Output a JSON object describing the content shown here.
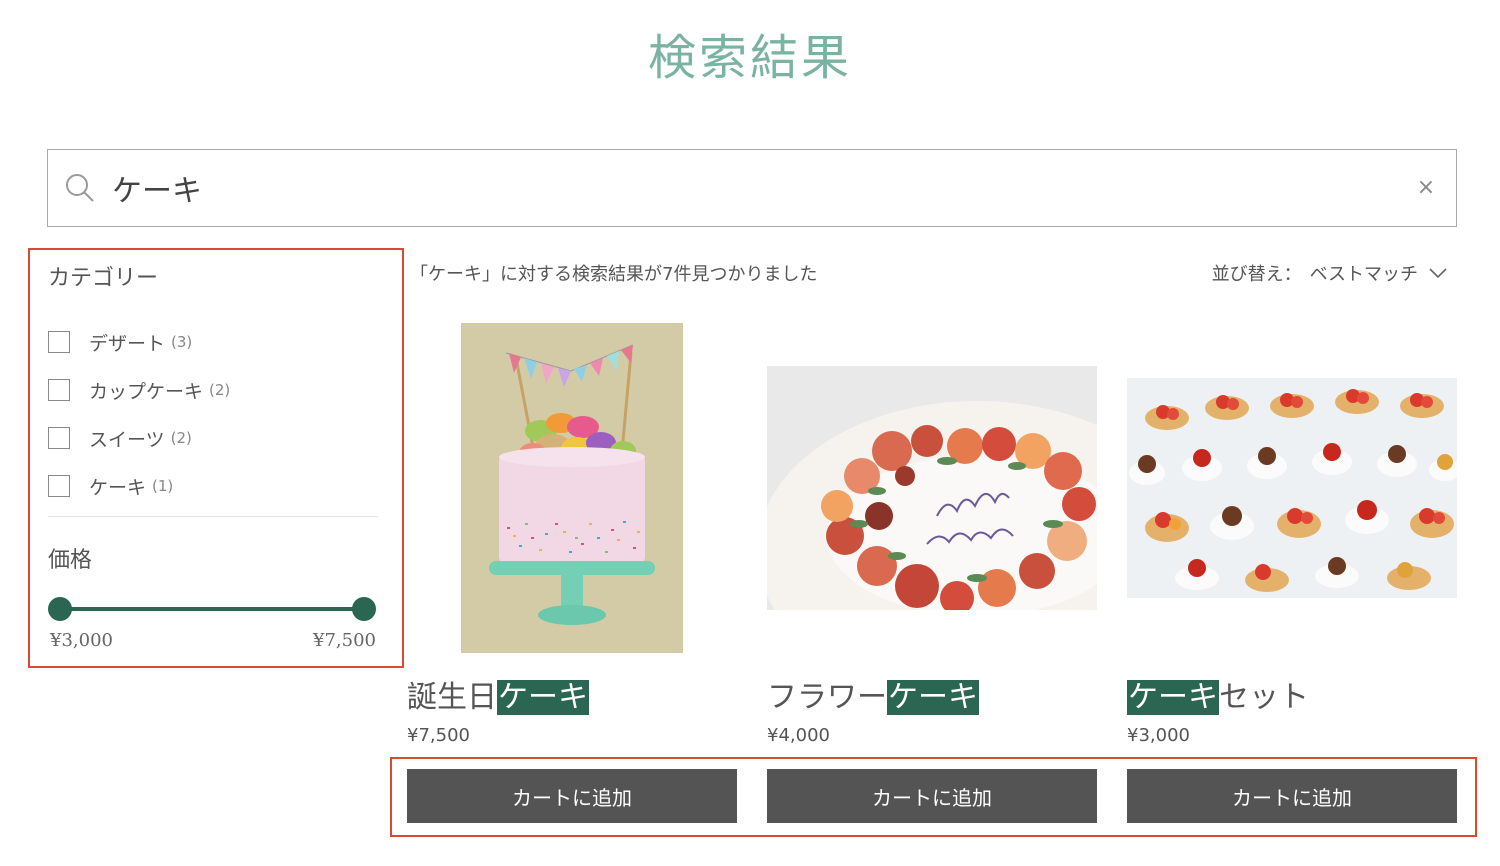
{
  "header": {
    "title": "検索結果"
  },
  "search": {
    "query": "ケーキ",
    "clear_label": "×"
  },
  "filters": {
    "category_heading": "カテゴリー",
    "categories": [
      {
        "label": "デザート",
        "count": "(3)"
      },
      {
        "label": "カップケーキ",
        "count": "(2)"
      },
      {
        "label": "スイーツ",
        "count": "(2)"
      },
      {
        "label": "ケーキ",
        "count": "(1)"
      }
    ],
    "price_heading": "価格",
    "price_min": "¥3,000",
    "price_max": "¥7,500"
  },
  "results": {
    "summary": "「ケーキ」に対する検索結果が7件見つかりました",
    "sort_label": "並び替え：",
    "sort_value": "ベストマッチ"
  },
  "products": [
    {
      "name_before": "誕生日",
      "name_match": "ケーキ",
      "name_after": "",
      "price": "¥7,500",
      "cart_label": "カートに追加"
    },
    {
      "name_before": "フラワー",
      "name_match": "ケーキ",
      "name_after": "",
      "price": "¥4,000",
      "cart_label": "カートに追加"
    },
    {
      "name_before": "",
      "name_match": "ケーキ",
      "name_after": "セット",
      "price": "¥3,000",
      "cart_label": "カートに追加"
    }
  ],
  "colors": {
    "title": "#7bb3a2",
    "accent": "#2a6651",
    "button": "#545454",
    "annotation_border": "#d94a34"
  },
  "icons": [
    "search-icon",
    "clear-icon",
    "chevron-down-icon"
  ]
}
